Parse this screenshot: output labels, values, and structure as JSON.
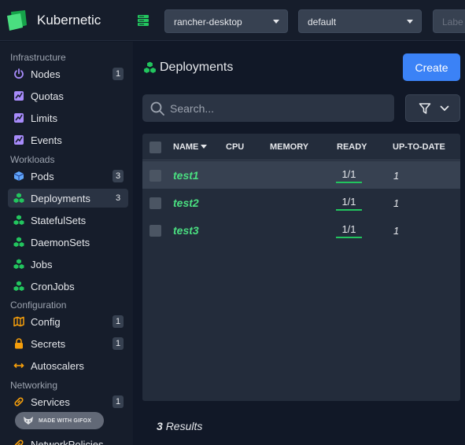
{
  "app": {
    "title": "Kubernetic"
  },
  "topbar": {
    "context": "rancher-desktop",
    "namespace": "default",
    "labels_placeholder": "Labe"
  },
  "sidebar": {
    "sections": [
      {
        "title": "Infrastructure",
        "items": [
          {
            "label": "Nodes",
            "icon": "power-icon",
            "badge": "1"
          },
          {
            "label": "Quotas",
            "icon": "chart-icon",
            "badge": ""
          },
          {
            "label": "Limits",
            "icon": "chart-icon",
            "badge": ""
          },
          {
            "label": "Events",
            "icon": "chart-icon",
            "badge": ""
          }
        ]
      },
      {
        "title": "Workloads",
        "items": [
          {
            "label": "Pods",
            "icon": "cube-icon",
            "badge": "3"
          },
          {
            "label": "Deployments",
            "icon": "cubes-icon",
            "badge": "3",
            "active": true
          },
          {
            "label": "StatefulSets",
            "icon": "cubes-icon",
            "badge": ""
          },
          {
            "label": "DaemonSets",
            "icon": "cubes-icon",
            "badge": ""
          },
          {
            "label": "Jobs",
            "icon": "cubes-icon",
            "badge": ""
          },
          {
            "label": "CronJobs",
            "icon": "cubes-icon",
            "badge": ""
          }
        ]
      },
      {
        "title": "Configuration",
        "items": [
          {
            "label": "Config",
            "icon": "map-icon",
            "badge": "1"
          },
          {
            "label": "Secrets",
            "icon": "lock-icon",
            "badge": "1"
          },
          {
            "label": "Autoscalers",
            "icon": "arrows-icon",
            "badge": ""
          }
        ]
      },
      {
        "title": "Networking",
        "items": [
          {
            "label": "Services",
            "icon": "link-icon",
            "badge": "1"
          },
          {
            "label": "NetworkPolicies",
            "icon": "link-icon",
            "badge": ""
          }
        ]
      }
    ],
    "watermark": "MADE WITH GIFOX"
  },
  "main": {
    "title": "Deployments",
    "create_label": "Create",
    "search_placeholder": "Search...",
    "columns": [
      "NAME",
      "CPU",
      "MEMORY",
      "READY",
      "UP-TO-DATE"
    ],
    "rows": [
      {
        "name": "test1",
        "cpu": "",
        "memory": "",
        "ready": "1/1",
        "uptodate": "1",
        "selected": true
      },
      {
        "name": "test2",
        "cpu": "",
        "memory": "",
        "ready": "1/1",
        "uptodate": "1"
      },
      {
        "name": "test3",
        "cpu": "",
        "memory": "",
        "ready": "1/1",
        "uptodate": "1"
      }
    ],
    "results_count": "3",
    "results_label": "Results"
  },
  "colors": {
    "accent": "#3b82f6",
    "name_green": "#4ade80",
    "icon_green": "#22c55e",
    "icon_orange": "#f59e0b",
    "icon_purple": "#a78bfa",
    "icon_blue": "#60a5fa"
  }
}
